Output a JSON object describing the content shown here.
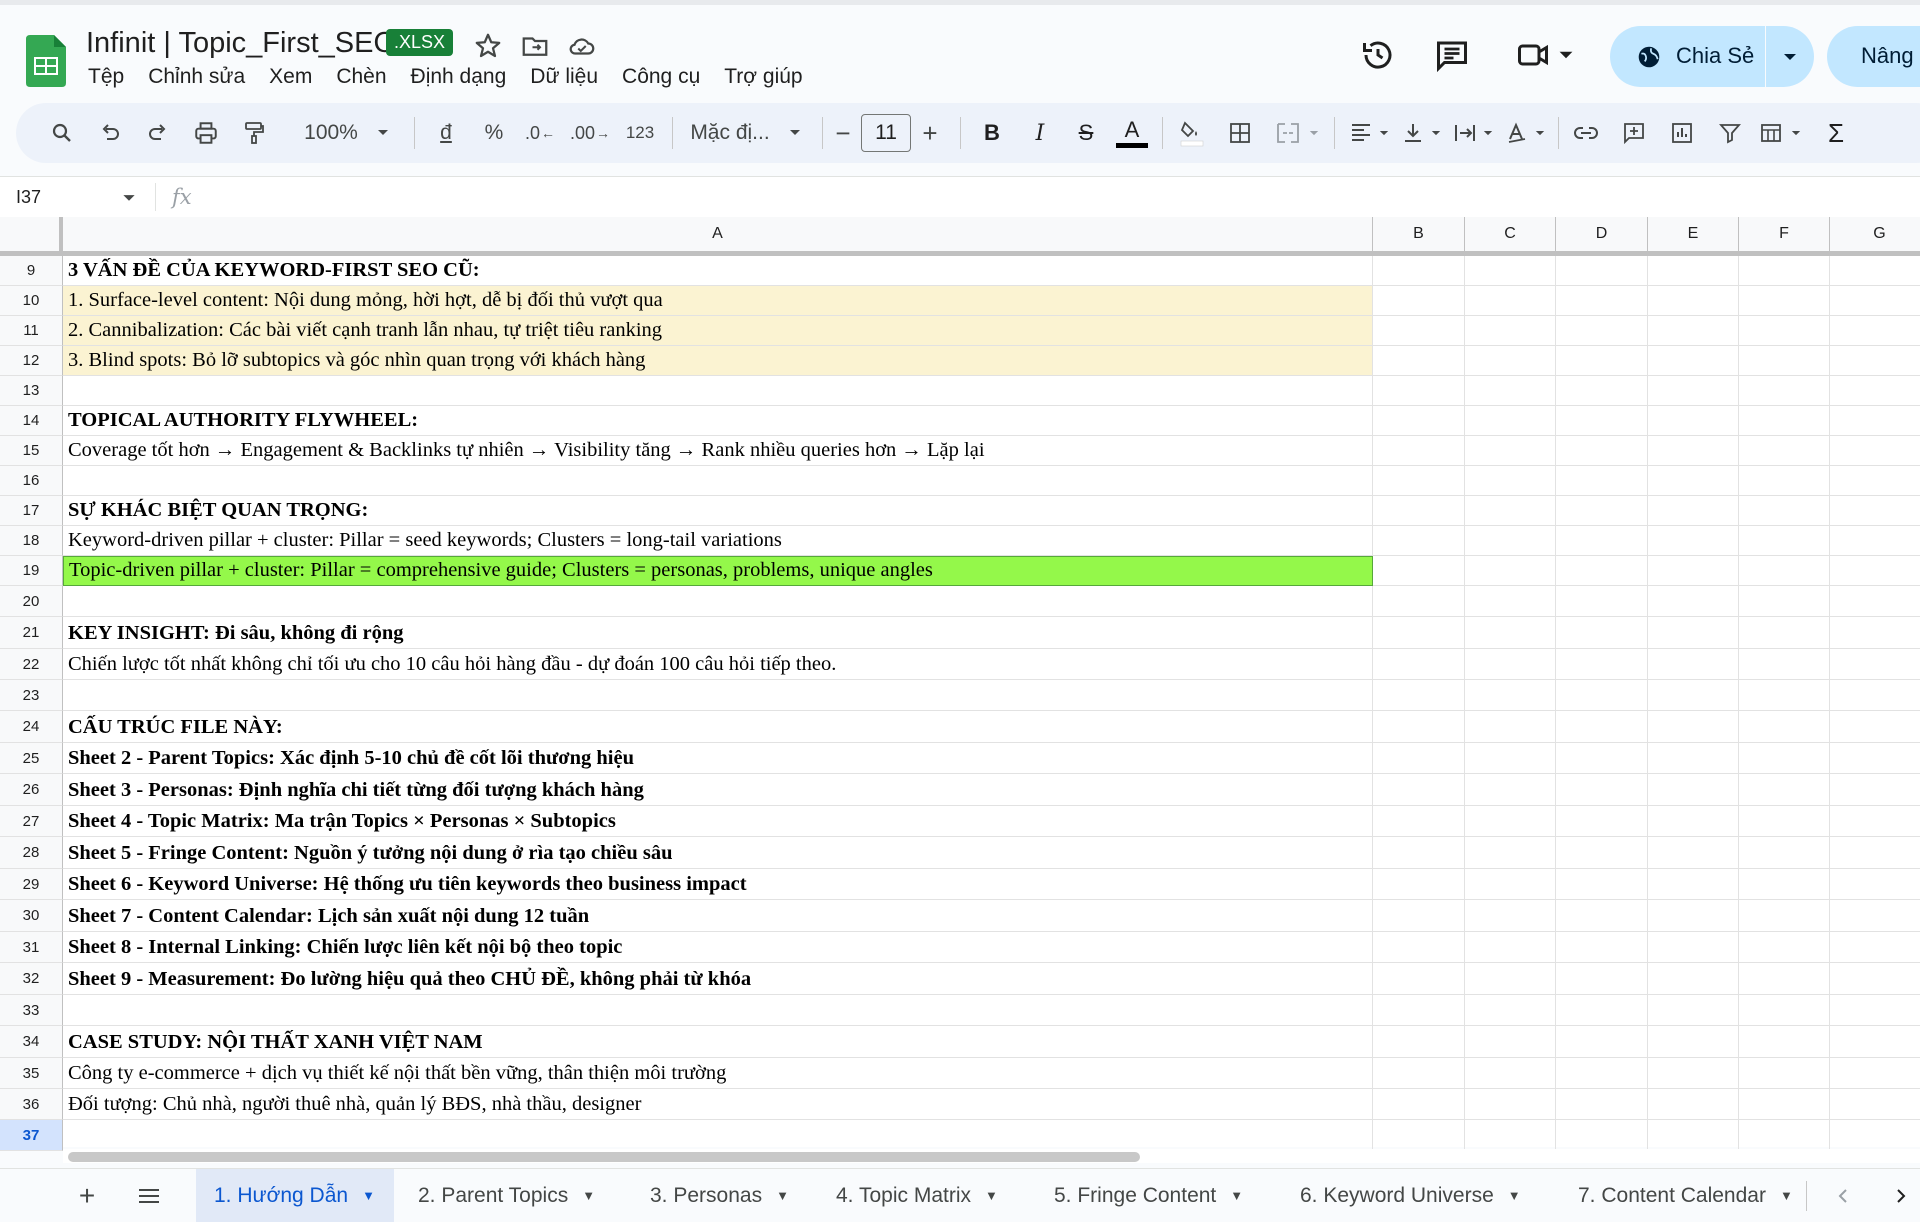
{
  "app": {
    "doc_title": "Infinit | Topic_First_SEO",
    "file_badge": ".XLSX",
    "menu": [
      "Tệp",
      "Chỉnh sửa",
      "Xem",
      "Chèn",
      "Định dạng",
      "Dữ liệu",
      "Công cụ",
      "Trợ giúp"
    ],
    "share_label": "Chia Sẻ",
    "upgrade_label": "Nâng c"
  },
  "toolbar": {
    "zoom": "100%",
    "currency": "đ",
    "percent": "%",
    "dec_decrease": ".0",
    "dec_increase": ".00",
    "number_format": "123",
    "font_name": "Mặc đị...",
    "font_size": "11",
    "minus": "−",
    "plus": "+",
    "bold": "B",
    "italic": "I",
    "strike": "S",
    "text_color": "A",
    "sum": "Σ"
  },
  "formula_bar": {
    "name_box": "I37",
    "fx": "fx",
    "value": ""
  },
  "columns": [
    "A",
    "B",
    "C",
    "D",
    "E",
    "F",
    "G"
  ],
  "rows": [
    {
      "num": "9",
      "text": "3 VẤN ĐỀ CỦA KEYWORD-FIRST SEO CŨ:",
      "style": "bold"
    },
    {
      "num": "10",
      "text": "1. Surface-level content: Nội dung mỏng, hời hợt, dễ bị đối thủ vượt qua",
      "style": "yellow"
    },
    {
      "num": "11",
      "text": "2. Cannibalization: Các bài viết cạnh tranh lẫn nhau, tự triệt tiêu ranking",
      "style": "yellow"
    },
    {
      "num": "12",
      "text": "3. Blind spots: Bỏ lỡ subtopics và góc nhìn quan trọng với khách hàng",
      "style": "yellow"
    },
    {
      "num": "13",
      "text": "",
      "style": ""
    },
    {
      "num": "14",
      "text": "TOPICAL AUTHORITY FLYWHEEL:",
      "style": "bold"
    },
    {
      "num": "15",
      "text": "Coverage tốt hơn → Engagement & Backlinks tự nhiên → Visibility tăng → Rank nhiều queries hơn → Lặp lại",
      "style": ""
    },
    {
      "num": "16",
      "text": "",
      "style": ""
    },
    {
      "num": "17",
      "text": "SỰ KHÁC BIỆT QUAN TRỌNG:",
      "style": "bold"
    },
    {
      "num": "18",
      "text": "Keyword-driven pillar + cluster: Pillar = seed keywords; Clusters = long-tail variations",
      "style": ""
    },
    {
      "num": "19",
      "text": "Topic-driven pillar + cluster: Pillar = comprehensive guide; Clusters = personas, problems, unique angles",
      "style": "green"
    },
    {
      "num": "20",
      "text": "",
      "style": ""
    },
    {
      "num": "21",
      "text": "KEY INSIGHT: Đi sâu, không đi rộng",
      "style": "bold"
    },
    {
      "num": "22",
      "text": "Chiến lược tốt nhất không chỉ tối ưu cho 10 câu hỏi hàng đầu - dự đoán 100 câu hỏi tiếp theo.",
      "style": ""
    },
    {
      "num": "23",
      "text": "",
      "style": ""
    },
    {
      "num": "24",
      "text": "CẤU TRÚC FILE NÀY:",
      "style": "bold"
    },
    {
      "num": "25",
      "text": "Sheet 2 - Parent Topics: Xác định 5-10 chủ đề cốt lõi thương hiệu",
      "style": "bold"
    },
    {
      "num": "26",
      "text": "Sheet 3 - Personas: Định nghĩa chi tiết từng đối tượng khách hàng",
      "style": "bold"
    },
    {
      "num": "27",
      "text": "Sheet 4 - Topic Matrix: Ma trận Topics × Personas × Subtopics",
      "style": "bold"
    },
    {
      "num": "28",
      "text": "Sheet 5 - Fringe Content: Nguồn ý tưởng nội dung ở rìa tạo chiều sâu",
      "style": "bold"
    },
    {
      "num": "29",
      "text": "Sheet 6 - Keyword Universe: Hệ thống ưu tiên keywords theo business impact",
      "style": "bold"
    },
    {
      "num": "30",
      "text": "Sheet 7 - Content Calendar: Lịch sản xuất nội dung 12 tuần",
      "style": "bold"
    },
    {
      "num": "31",
      "text": "Sheet 8 - Internal Linking: Chiến lược liên kết nội bộ theo topic",
      "style": "bold"
    },
    {
      "num": "32",
      "text": "Sheet 9 - Measurement: Đo lường hiệu quả theo CHỦ ĐỀ, không phải từ khóa",
      "style": "bold"
    },
    {
      "num": "33",
      "text": "",
      "style": ""
    },
    {
      "num": "34",
      "text": "CASE STUDY: NỘI THẤT XANH VIỆT NAM",
      "style": "bold"
    },
    {
      "num": "35",
      "text": "Công ty e-commerce + dịch vụ thiết kế nội thất bền vững, thân thiện môi trường",
      "style": ""
    },
    {
      "num": "36",
      "text": "Đối tượng: Chủ nhà, người thuê nhà, quản lý BĐS, nhà thầu, designer",
      "style": ""
    },
    {
      "num": "37",
      "text": "",
      "style": "",
      "active": true
    }
  ],
  "sheet_tabs": [
    "1. Hướng Dẫn",
    "2. Parent Topics",
    "3. Personas",
    "4. Topic Matrix",
    "5. Fringe Content",
    "6. Keyword Universe",
    "7. Content Calendar"
  ],
  "colors": {
    "yellow_fill": "#fbf3d2",
    "green_fill": "#94f84a",
    "share_bg": "#c2e7ff",
    "sheets_green": "#188038"
  }
}
